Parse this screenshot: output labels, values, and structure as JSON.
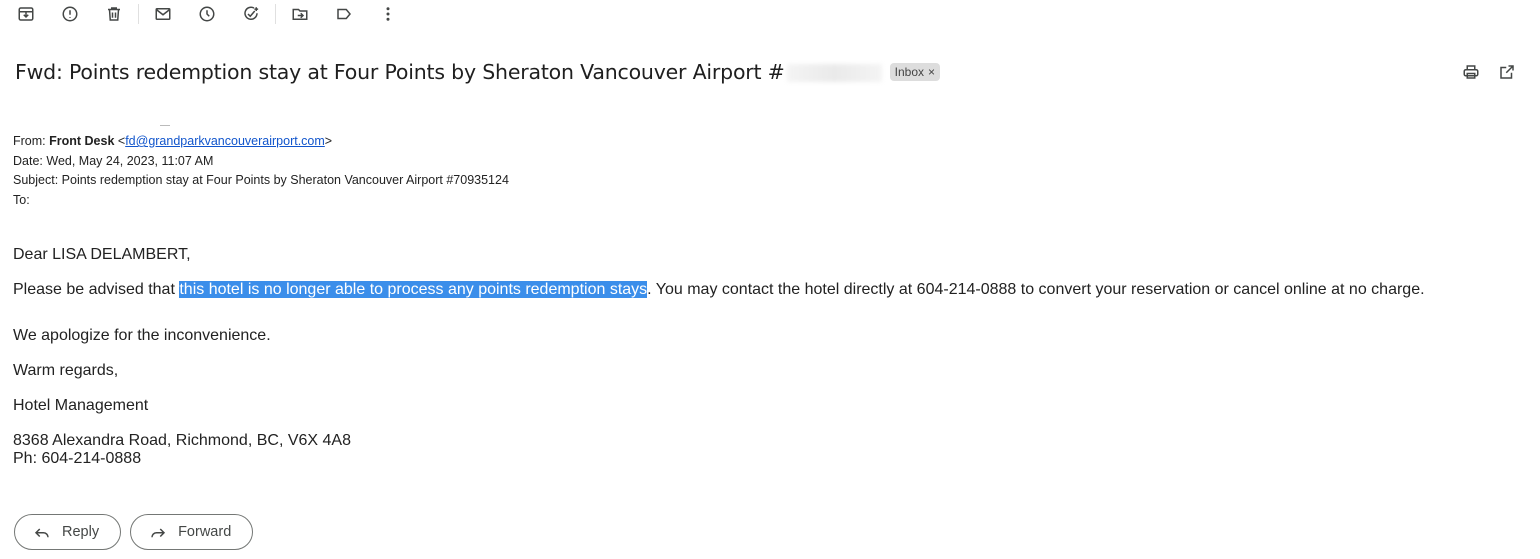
{
  "toolbar": {
    "items": [
      {
        "name": "archive-icon"
      },
      {
        "name": "report-spam-icon"
      },
      {
        "name": "delete-icon"
      },
      {
        "name": "mark-unread-icon"
      },
      {
        "name": "snooze-icon"
      },
      {
        "name": "add-task-icon"
      },
      {
        "name": "move-to-icon"
      },
      {
        "name": "label-icon"
      },
      {
        "name": "more-options-icon"
      }
    ]
  },
  "email": {
    "subject": "Fwd: Points redemption stay at Four Points by Sheraton Vancouver Airport #",
    "label_badge": "Inbox",
    "badge_close": "×"
  },
  "header_actions": {
    "print": "print-icon",
    "open_new_window": "open-new-window-icon"
  },
  "forwarded": {
    "from_label": "From:",
    "from_name": "Front Desk",
    "from_email": "fd@grandparkvancouverairport.com",
    "date_label": "Date:",
    "date_value": "Wed, May 24, 2023, 11:07 AM",
    "subject_label": "Subject:",
    "subject_value": "Points redemption stay at Four Points by Sheraton Vancouver Airport #70935124",
    "to_label": "To:"
  },
  "body": {
    "greeting": "Dear LISA DELAMBERT,",
    "para1_before": "Please be advised that ",
    "para1_highlight": "this hotel is no longer able to process any points redemption stays",
    "para1_after": ". You may contact the hotel directly at 604-214-0888 to convert your reservation or cancel online at no charge.",
    "apology": "We apologize for the inconvenience.",
    "closing": "Warm regards,",
    "signature": "Hotel Management",
    "address": "8368 Alexandra Road, Richmond, BC, V6X 4A8",
    "phone": "Ph: 604-214-0888"
  },
  "actions": {
    "reply_label": "Reply",
    "forward_label": "Forward"
  }
}
